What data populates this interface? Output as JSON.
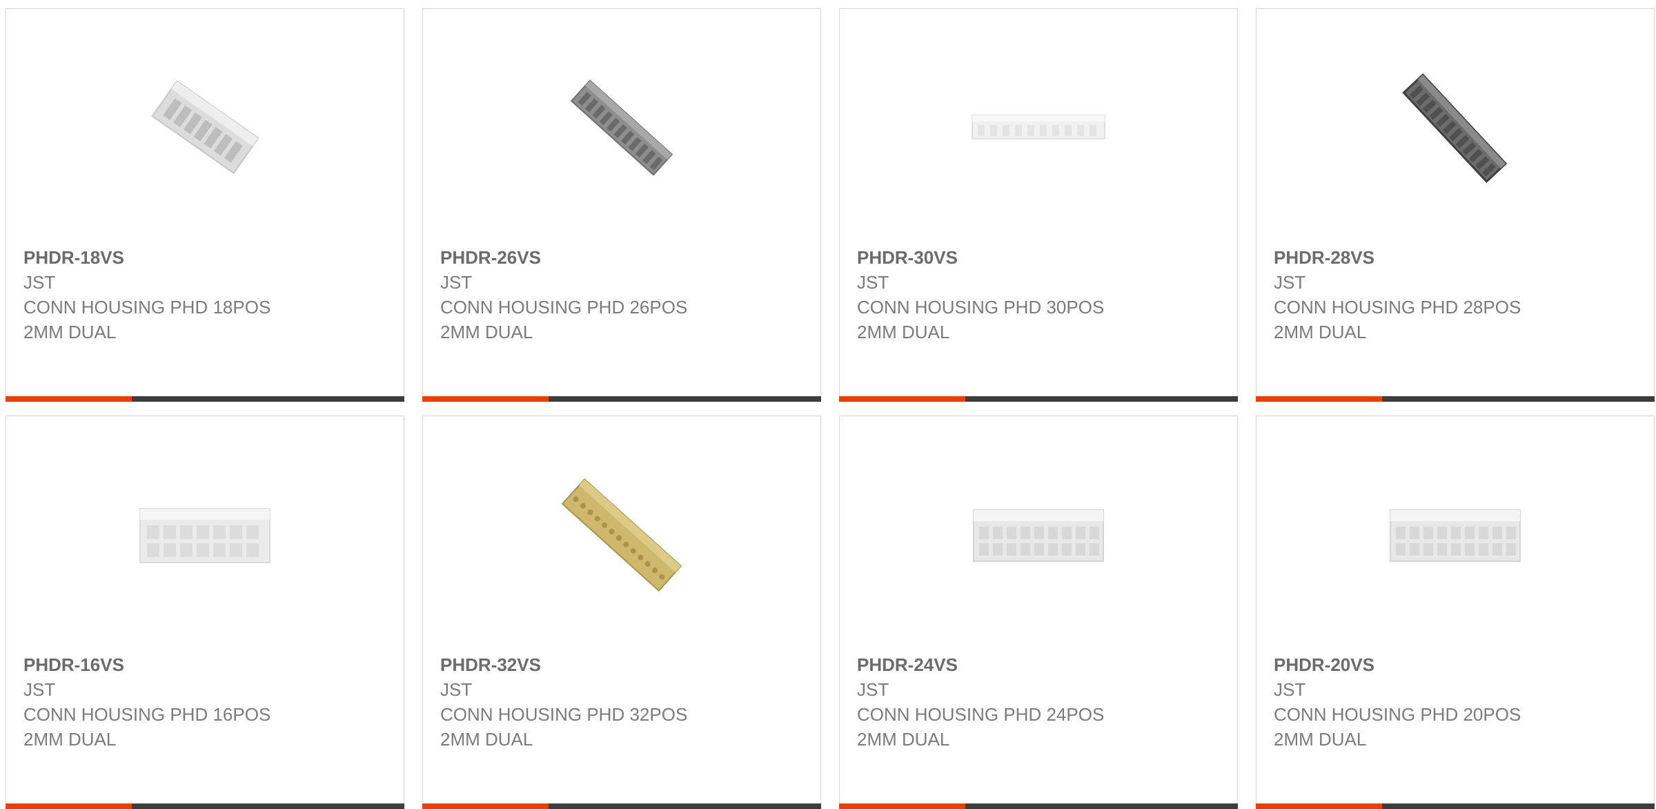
{
  "products": [
    {
      "part": "PHDR-18VS",
      "maker": "JST",
      "desc1": "CONN HOUSING PHD 18POS",
      "desc2": "2MM DUAL",
      "image": "white-housing-angled-icon",
      "color": "#d8d8d8"
    },
    {
      "part": "PHDR-26VS",
      "maker": "JST",
      "desc1": "CONN HOUSING PHD 26POS",
      "desc2": "2MM DUAL",
      "image": "gray-housing-angled-icon",
      "color": "#8a8a8a"
    },
    {
      "part": "PHDR-30VS",
      "maker": "JST",
      "desc1": "CONN HOUSING PHD 30POS",
      "desc2": "2MM DUAL",
      "image": "white-housing-flat-icon",
      "color": "#eeeeee"
    },
    {
      "part": "PHDR-28VS",
      "maker": "JST",
      "desc1": "CONN HOUSING PHD 28POS",
      "desc2": "2MM DUAL",
      "image": "dark-housing-angled-icon",
      "color": "#5e5e5e"
    },
    {
      "part": "PHDR-16VS",
      "maker": "JST",
      "desc1": "CONN HOUSING PHD 16POS",
      "desc2": "2MM DUAL",
      "image": "white-housing-front-icon",
      "color": "#e8e8e8"
    },
    {
      "part": "PHDR-32VS",
      "maker": "JST",
      "desc1": "CONN HOUSING PHD 32POS",
      "desc2": "2MM DUAL",
      "image": "tan-housing-angled-icon",
      "color": "#c9b46a"
    },
    {
      "part": "PHDR-24VS",
      "maker": "JST",
      "desc1": "CONN HOUSING PHD 24POS",
      "desc2": "2MM DUAL",
      "image": "white-housing-front-icon",
      "color": "#e6e6e6"
    },
    {
      "part": "PHDR-20VS",
      "maker": "JST",
      "desc1": "CONN HOUSING PHD 20POS",
      "desc2": "2MM DUAL",
      "image": "white-housing-front-icon",
      "color": "#e6e6e6"
    }
  ],
  "theme": {
    "accent": "#e8400c",
    "bar": "#3d3d3d",
    "text": "#7b7b7b",
    "border": "#d6d6d6"
  }
}
